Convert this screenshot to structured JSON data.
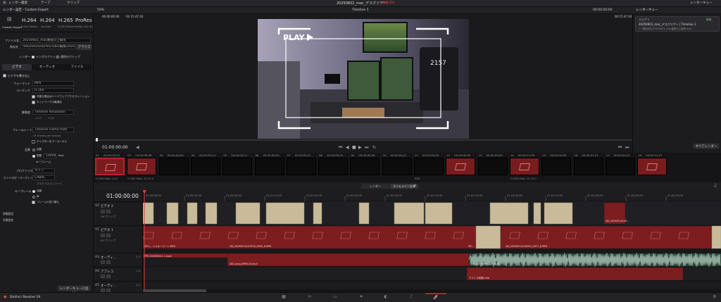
{
  "topbar": {
    "menu1": "レンダー履歴",
    "menu2": "テープ",
    "menu3": "クリップ",
    "project_title": "20250601_mac_デスクツアー",
    "project_status": "編集済み",
    "workspace": "レンダーキュー"
  },
  "panelhead": {
    "left_title": "レンダー設定 - Custom Export",
    "zoom": "59%",
    "timeline_name": "Timeline 1",
    "timecode": "00:00:00:00",
    "right_title": "レンダーキュー"
  },
  "presets": [
    {
      "label": "Custom Export",
      "sub": ""
    },
    {
      "label": "H.264",
      "sub": "H.264 Master"
    },
    {
      "label": "H.264",
      "sub": "YouTube"
    },
    {
      "label": "H.265",
      "sub": "H.265 Master"
    },
    {
      "label": "ProRes",
      "sub": "ProRes 422 HQ"
    }
  ],
  "file_settings": {
    "filename_label": "ファイル名",
    "filename_value": "20250601_mac番長の上級等",
    "location_label": "保存先",
    "location_value": "/Volumes/SSD/YouTube/編集/20250601_",
    "browse": "ブラウズ",
    "render_label": "レンダー",
    "single_clip": "シングルクリップ",
    "individual_clips": "個別のクリップ"
  },
  "tabs": {
    "video": "ビデオ",
    "audio": "オーディオ",
    "file": "ファイル"
  },
  "video_settings": {
    "export_video": "ビデオを書き出し",
    "format_label": "フォーマット",
    "format_value": "MP4",
    "codec_label": "コーデック",
    "codec_value": "H.264",
    "hw_accel": "可能な場合はハードウェアアクセラレーション",
    "network_opt": "ネットワークの最適化",
    "res_label": "解像度",
    "res_value": "Timeline Resolution",
    "res_sub1": "1920",
    "res_sub2": "1080",
    "fps_label": "フレームレート",
    "fps_value": "Timeline Frame Rate",
    "fps_sub": "24 frames per second",
    "chapters": "チャプターをマーカーから",
    "quality_label": "品質",
    "quality_auto": "自動",
    "quality_limit": "制限",
    "quality_value": "10000",
    "quality_unit": "Kb/s",
    "keyframes_label": "キーフレーム",
    "profile_label": "プロファイル",
    "profile_value": "メイン",
    "entropy_label": "エントロピーコーディング",
    "entropy_value": "CABAC",
    "multipass": "マルチパスエンコード",
    "kf_label": "キーフレーム",
    "kf_auto": "自動",
    "kf_every": "毎",
    "frame_reorder": "フレームの並べ替え",
    "advanced": "詳細設定",
    "subtitles": "字幕設定",
    "add_queue": "レンダーキューに追加"
  },
  "viewer": {
    "tc_left": "00:00:00:00",
    "duration": "01:15:47:03",
    "tc_current": "01:00:00:00",
    "tc_right": "00:15:47:04",
    "play_text": "PLAY",
    "monitor_text": "2157"
  },
  "queue": {
    "job_title": "ジョブ 1",
    "job_name": "20250601_mac_デスクツアー | Timeline 1",
    "job_path": "/ 一番保存先/20250601_mac番長の上級等.mp4",
    "edit_link": "編集",
    "render_all": "すべてレンダー"
  },
  "clips": [
    {
      "num": "01",
      "tc": "00:00:00;00",
      "label": "H.264 Main L4.0",
      "red": true,
      "sel": true
    },
    {
      "num": "02",
      "tc": "04:55:05;08",
      "label": "H.265 Main 10 L5.0",
      "red": true,
      "sel": false
    },
    {
      "num": "03",
      "tc": "00:00:00;00",
      "label": "",
      "red": false,
      "sel": false
    },
    {
      "num": "04",
      "tc": "00:00:00;14",
      "label": "",
      "red": false,
      "sel": false
    },
    {
      "num": "05",
      "tc": "00:00:00;21",
      "label": "",
      "red": false,
      "sel": false
    },
    {
      "num": "06",
      "tc": "00:00:00;00",
      "label": "",
      "red": false,
      "sel": false
    },
    {
      "num": "07",
      "tc": "00:00:00;21",
      "label": "",
      "red": false,
      "sel": false
    },
    {
      "num": "08",
      "tc": "00:00:00;00",
      "label": "",
      "red": false,
      "sel": false
    },
    {
      "num": "09",
      "tc": "00:00:00;08",
      "label": "",
      "red": false,
      "sel": false
    },
    {
      "num": "10",
      "tc": "00:00:00;21",
      "label": "",
      "red": false,
      "sel": false
    },
    {
      "num": "11",
      "tc": "00:00:00;00",
      "label": "PNG",
      "red": false,
      "sel": false
    },
    {
      "num": "12",
      "tc": "00:00:00;00",
      "label": "",
      "red": true,
      "sel": false
    },
    {
      "num": "13",
      "tc": "00:00:00;00",
      "label": "",
      "red": false,
      "sel": false
    },
    {
      "num": "14",
      "tc": "00:00:12;26",
      "label": "H.265 Main 10 L5.0",
      "red": true,
      "sel": false
    },
    {
      "num": "15",
      "tc": "00:00:00;00",
      "label": "",
      "red": false,
      "sel": false
    },
    {
      "num": "16",
      "tc": "00:00:01;21",
      "label": "",
      "red": false,
      "sel": false
    },
    {
      "num": "17",
      "tc": "00:00:00;21",
      "label": "",
      "red": false,
      "sel": false
    },
    {
      "num": "18",
      "tc": "04:55:21;23",
      "label": "",
      "red": true,
      "sel": false
    }
  ],
  "timeline": {
    "timecode": "01:00:00:00",
    "tab_a": "レンダー",
    "tab_b": "タイムライン全体",
    "ruler": [
      "01:00:00:00",
      "01:00:25:00",
      "01:00:50:00",
      "01:01:15:00",
      "01:01:40:00",
      "01:02:05:00",
      "01:02:30:00",
      "01:02:55:00",
      "01:03:20:00",
      "01:03:45:00",
      "01:04:10:00",
      "01:04:35:00",
      "01:05:00:00",
      "01:05:25:00"
    ],
    "tracks": [
      {
        "id": "V2",
        "name": "ビデオ 2",
        "count": "26 クリップ"
      },
      {
        "id": "V1",
        "name": "ビデオ 1",
        "count": "63 クリップ"
      },
      {
        "id": "A3",
        "name": "オーディ...",
        "count": "2.0"
      },
      {
        "id": "A4",
        "name": "アフレコ",
        "count": "1.0"
      },
      {
        "id": "A5",
        "name": "オーディ...",
        "count": "2.0"
      }
    ],
    "clip_labels": {
      "v1_a": "iPCレ...トルキーナーン.MP4",
      "v1_b": "Q6_20250514123516_0900_D.MP4",
      "v1_c": "iPC...",
      "v1_d": "Q6_20250514144052_0677_D.MP4",
      "v2_a": "Q6_20250514140...",
      "a3_a": "TPS 202505011 1.mp4",
      "a3_b": "280_long_BPM120.mp3",
      "a3_c": "280_long_BPM120.mp3",
      "a4_a": "アフレコ収録.m4a"
    }
  },
  "bottom": {
    "app": "DaVinci Resolve 19"
  },
  "colors": {
    "accent_red": "#b8222a",
    "clip_beige": "#c9bb9a",
    "clip_red": "#7d1d20",
    "audio_green": "#2f4a3f"
  }
}
